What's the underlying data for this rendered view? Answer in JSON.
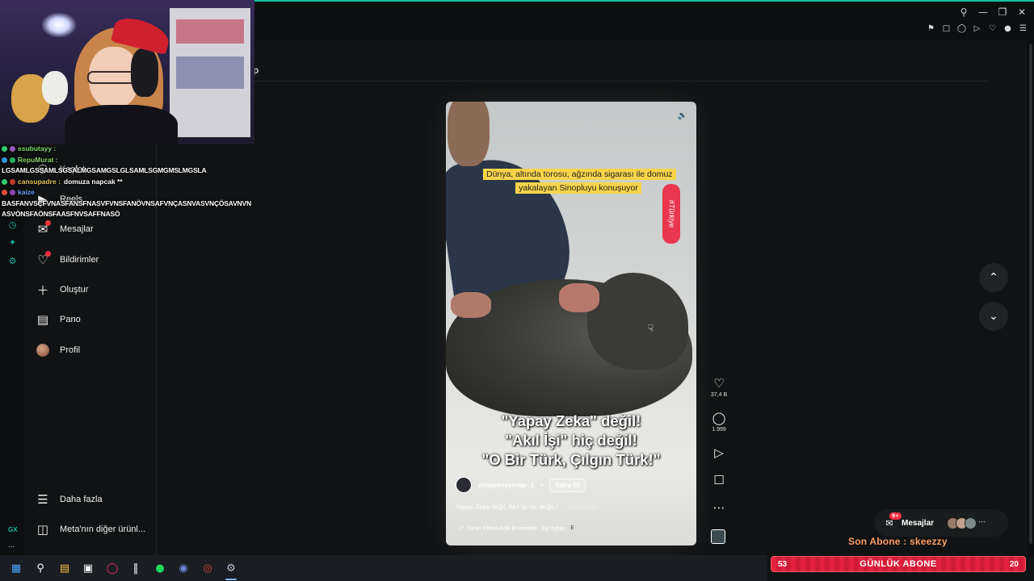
{
  "browser": {
    "window_controls": [
      "search-icon",
      "minimize-icon",
      "restore-icon",
      "close-icon"
    ],
    "toolbar_icons": [
      "pin-icon",
      "tab-icon",
      "shield-icon",
      "play-icon",
      "heart-icon",
      "account-icon",
      "menu-icon"
    ],
    "rail_label": "GX",
    "rail_more": "..."
  },
  "stream_chat": {
    "messages": [
      {
        "user": "ssubutayy :",
        "text": "",
        "user_color": "#7fdc6a",
        "badge_color": "#2ecc71"
      },
      {
        "user": "RepuMurat :",
        "text": "",
        "user_color": "#8fd46a",
        "badge_color": "#3498db"
      },
      {
        "user": "",
        "text": "LGSAMLGSSAMLSGSALMGSAMGSLGLSAMLSGMGMSLMGSLA",
        "user_color": "#ffffff",
        "badge_color": ""
      },
      {
        "user": "cansupadre :",
        "text": "domuza napcak **",
        "user_color": "#e8c15a",
        "badge_color": "#2ecc71"
      },
      {
        "user": "kaize",
        "text": "",
        "user_color": "#6aa0ff",
        "badge_color": "#e74c3c"
      },
      {
        "user": "",
        "text": "BASFANVSÇFVNASFANSFNASVFVNSFANÖVNSAFVNÇASNVASVNÇÖSAVNVN",
        "user_color": "#ffffff",
        "badge_color": ""
      },
      {
        "user": "",
        "text": "ASVÖNSFAÖNSFAASFNVSAFFNASÖ",
        "user_color": "#ffffff",
        "badge_color": ""
      }
    ]
  },
  "instagram": {
    "header_fragment": "p",
    "sidebar": {
      "items": [
        {
          "label": "Keşfet",
          "icon": "explore-icon"
        },
        {
          "label": "Reels",
          "icon": "reels-icon"
        },
        {
          "label": "Mesajlar",
          "icon": "messenger-icon"
        },
        {
          "label": "Bildirimler",
          "icon": "heart-icon"
        },
        {
          "label": "Oluştur",
          "icon": "plus-icon"
        },
        {
          "label": "Pano",
          "icon": "dashboard-icon"
        },
        {
          "label": "Profil",
          "icon": "profile-avatar"
        }
      ],
      "more_label": "Daha fazla",
      "meta_label": "Meta'nın diğer ürünl..."
    },
    "reel": {
      "top_caption": "Dünya, altında torosu, ağzında sigarası ile domuz yakalayan Sinopluyu konuşuyor",
      "tag": "#Türkiye",
      "overlay_lines": [
        "\"Yapay Zeka\" değil!",
        "\"Akıl İşi\" hiç değil!",
        "\"O Bir Türk, Çılgın Türk!\""
      ],
      "author": "dilegelmeyenler_1",
      "separator": "•",
      "follow_label": "Takip Et",
      "description": "Yapay Zeka değil, Akıl İşi hiç değil..!",
      "more_label": "... daha fazla",
      "music_icon": "trend-arrow-icon",
      "music": "Turan Ethno-Folk Ensemble · Ep Typan",
      "music_badge": "E"
    },
    "actions": {
      "likes": "37,4 B",
      "comments": "1.999"
    },
    "messages_pill": {
      "label": "Mesajlar",
      "badge": "9+"
    }
  },
  "stream_overlay": {
    "last_sub": "Son Abone : skeezzy",
    "daily_sub_label": "GÜNLÜK ABONE",
    "daily_sub_current": "53",
    "daily_sub_goal": "20"
  },
  "taskbar": {
    "icons": [
      "windows-start-icon",
      "search-icon",
      "file-explorer-icon",
      "app-icon",
      "opera-gx-icon",
      "audio-app-icon",
      "spotify-icon",
      "discord-icon",
      "chrome-icon",
      "settings-icon"
    ]
  },
  "colors": {
    "accent": "#12bfa6",
    "notification": "#ff3040",
    "sub_bar": "#e3223e"
  }
}
